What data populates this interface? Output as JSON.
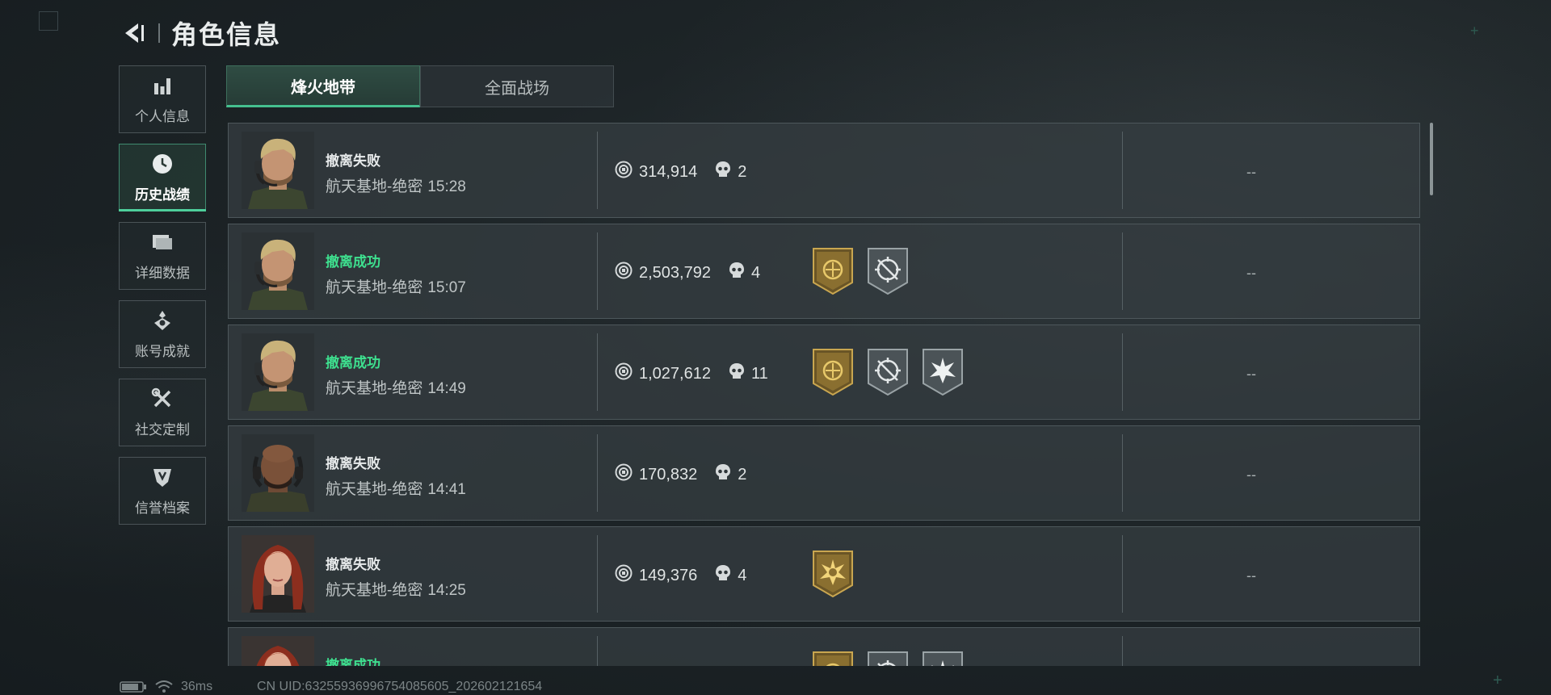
{
  "header": {
    "title": "角色信息"
  },
  "sidebar": {
    "items": [
      {
        "label": "个人信息",
        "icon": "bar-chart-icon",
        "active": false
      },
      {
        "label": "历史战绩",
        "icon": "clock-icon",
        "active": true
      },
      {
        "label": "详细数据",
        "icon": "folder-icon",
        "active": false
      },
      {
        "label": "账号成就",
        "icon": "medal-icon",
        "active": false
      },
      {
        "label": "社交定制",
        "icon": "wrench-icon",
        "active": false
      },
      {
        "label": "信誉档案",
        "icon": "shield-icon",
        "active": false
      }
    ]
  },
  "tabs": [
    {
      "label": "烽火地带",
      "active": true
    },
    {
      "label": "全面战场",
      "active": false
    }
  ],
  "records": [
    {
      "status": "撤离失败",
      "result": "fail",
      "map": "航天基地-绝密",
      "time": "15:28",
      "value": "314,914",
      "kills": "2",
      "badges": [],
      "extra": "--",
      "avatar": "blond-operator"
    },
    {
      "status": "撤离成功",
      "result": "success",
      "map": "航天基地-绝密",
      "time": "15:07",
      "value": "2,503,792",
      "kills": "4",
      "badges": [
        "gold-emblem-badge",
        "crosshair-badge"
      ],
      "extra": "--",
      "avatar": "blond-operator"
    },
    {
      "status": "撤离成功",
      "result": "success",
      "map": "航天基地-绝密",
      "time": "14:49",
      "value": "1,027,612",
      "kills": "11",
      "badges": [
        "gold-emblem-badge",
        "crosshair-badge",
        "burst-badge"
      ],
      "extra": "--",
      "avatar": "blond-operator"
    },
    {
      "status": "撤离失败",
      "result": "fail",
      "map": "航天基地-绝密",
      "time": "14:41",
      "value": "170,832",
      "kills": "2",
      "badges": [],
      "extra": "--",
      "avatar": "bald-operator"
    },
    {
      "status": "撤离失败",
      "result": "fail",
      "map": "航天基地-绝密",
      "time": "14:25",
      "value": "149,376",
      "kills": "4",
      "badges": [
        "gold-burst-badge"
      ],
      "extra": "--",
      "avatar": "red-hair-operator"
    },
    {
      "status": "撤离成功",
      "result": "success",
      "map": "",
      "time": "",
      "value": "",
      "kills": "",
      "badges": [
        "gold-emblem-badge",
        "crosshair-badge",
        "burst-badge"
      ],
      "extra": "",
      "avatar": "red-hair-operator"
    }
  ],
  "footer": {
    "latency": "36ms",
    "uid": "CN UID:63255936996754085605_202602121654"
  },
  "colors": {
    "accent": "#45c08f",
    "success": "#3ee08f",
    "gold": "#b8973f"
  }
}
